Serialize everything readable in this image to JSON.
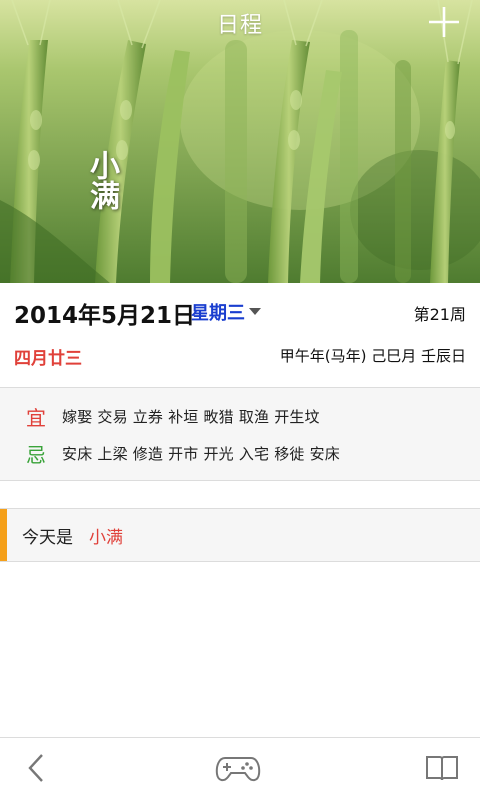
{
  "header": {
    "title": "日程",
    "add_icon": "plus-icon"
  },
  "banner": {
    "solar_term": "小满"
  },
  "date": {
    "gregorian": "2014年5月21日",
    "weekday": "星期三",
    "week_number": "第21周",
    "lunar": "四月廿三",
    "ganzhi": "甲午年(马年)  己巳月  壬辰日"
  },
  "almanac": {
    "yi_mark": "宜",
    "yi_items": "嫁娶 交易 立券 补垣 畋猎 取渔 开生坟",
    "ji_mark": "忌",
    "ji_items": "安床 上梁 修造 开市 开光 入宅 移徙 安床"
  },
  "festival": {
    "label": "今天是",
    "value": "小满"
  },
  "bottom_nav": {
    "back_icon": "chevron-left-icon",
    "game_icon": "gamepad-icon",
    "book_icon": "book-icon"
  },
  "colors": {
    "accent_red": "#e0413a",
    "accent_green": "#3aa33a",
    "weekday_blue": "#1a3ecf",
    "festival_accent": "#f5a01a"
  }
}
